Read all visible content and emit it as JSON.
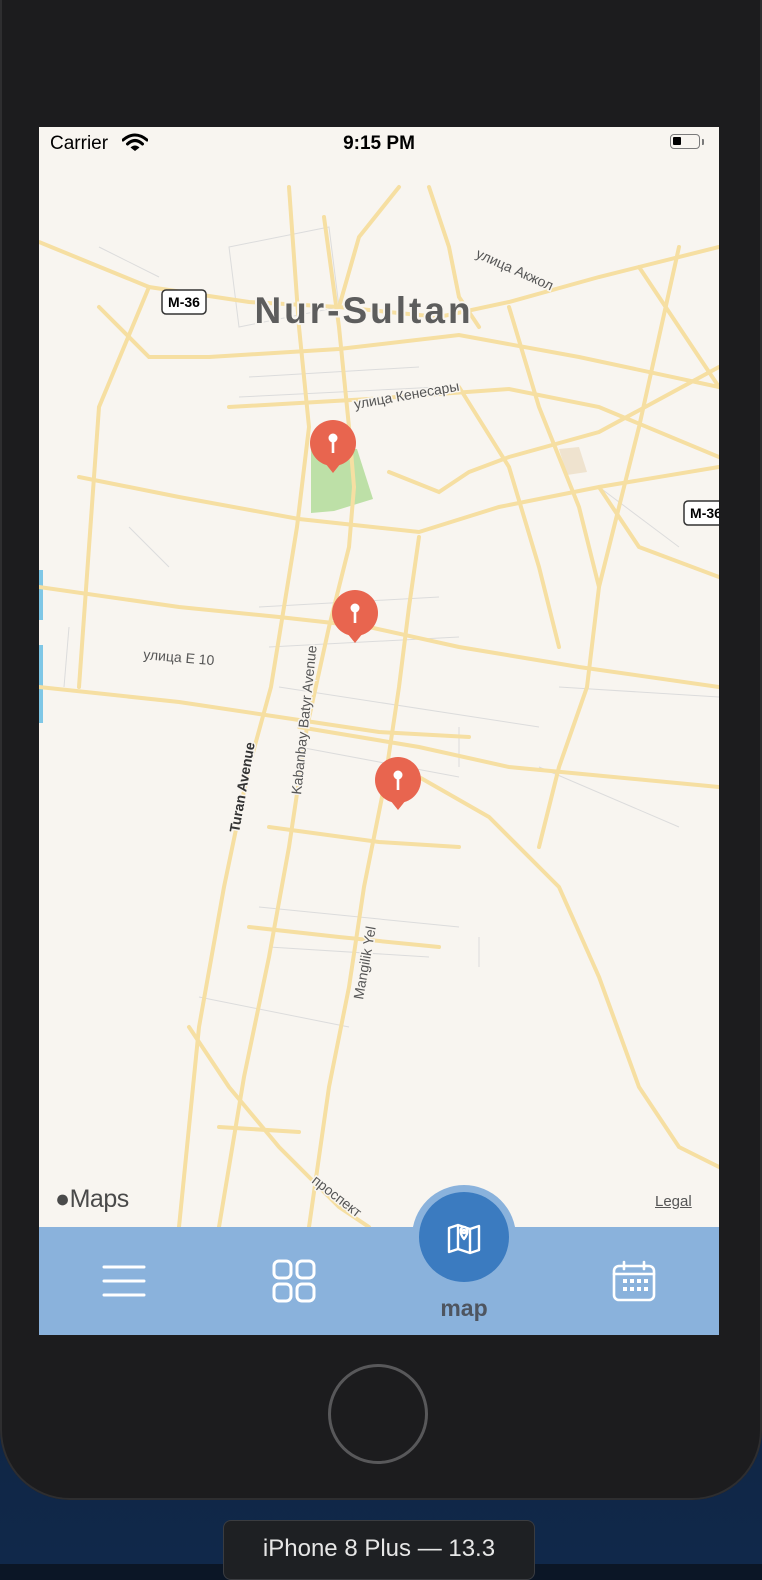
{
  "status_bar": {
    "carrier": "Carrier",
    "time": "9:15 PM"
  },
  "map": {
    "city_label": "Nur-Sultan",
    "highway_shields": [
      "M-36",
      "M-36"
    ],
    "street_labels": {
      "akzhol": "улица Акжол",
      "kenesary": "улица Кенесары",
      "e10": "улица Е 10",
      "kabanbay": "Kabanbay Batyr Avenue",
      "turan": "Turan Avenue",
      "mangilik": "Mangilik Yel",
      "prospekt": "проспект"
    },
    "pins": 3,
    "attribution": "Maps",
    "legal": "Legal"
  },
  "tab_bar": {
    "active_label": "map"
  },
  "device_label": "iPhone 8 Plus — 13.3",
  "colors": {
    "pin": "#e8654f",
    "tab_bar": "#8ab2dc",
    "active_tab": "#3b7bc0",
    "road": "#f6dfa2"
  },
  "icons": {
    "menu": "hamburger-menu-icon",
    "grid": "grid-icon",
    "map": "map-icon",
    "calendar": "calendar-icon",
    "pin": "map-pin-icon"
  }
}
